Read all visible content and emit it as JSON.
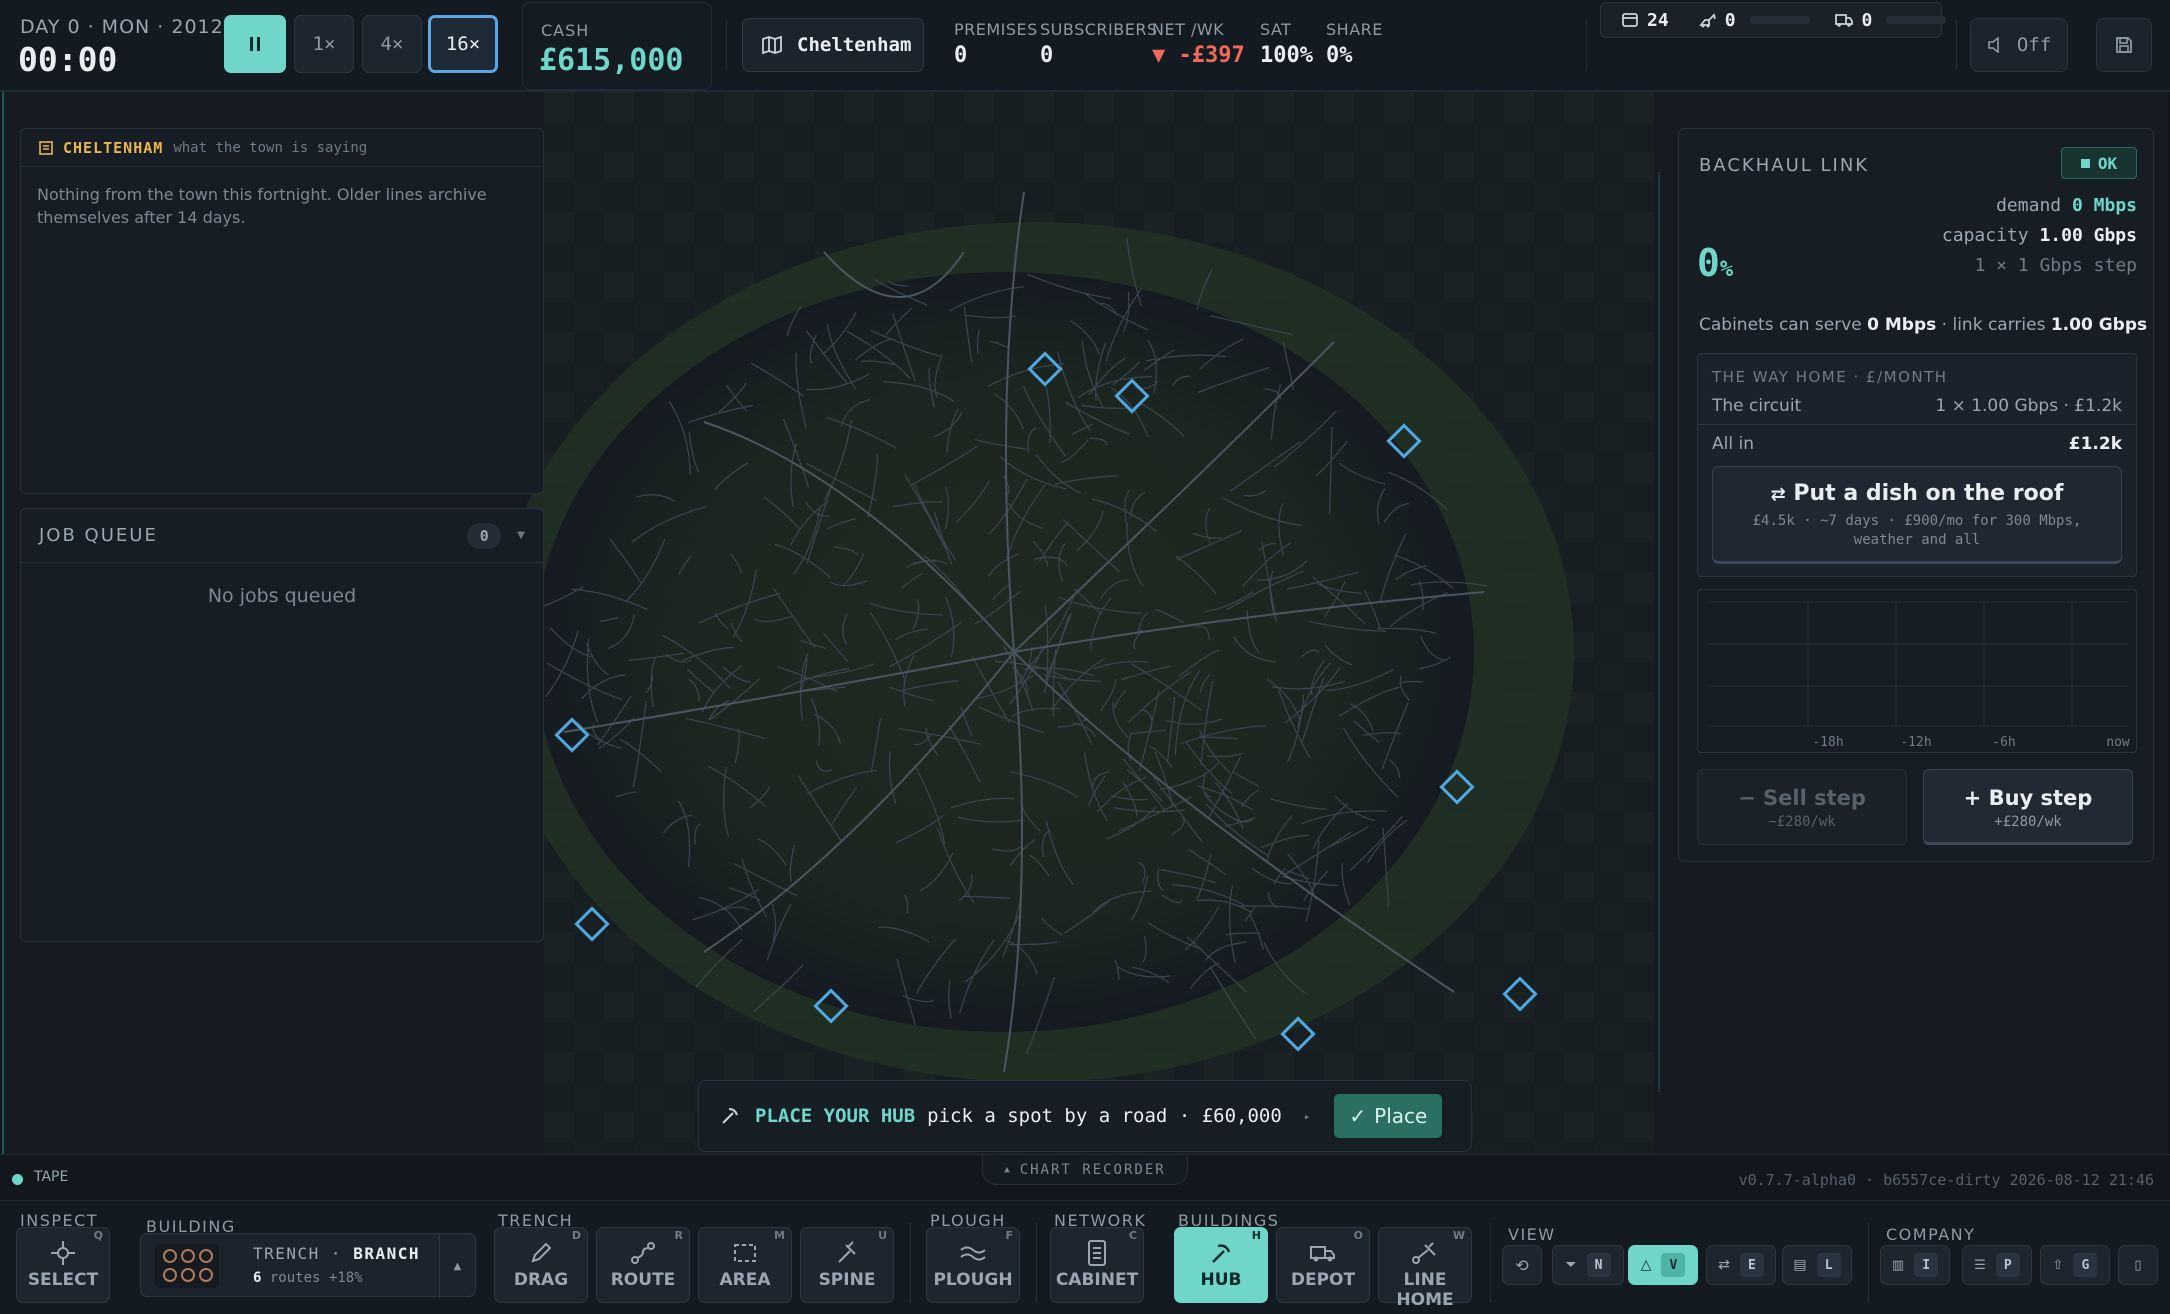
{
  "topbar": {
    "date": "DAY 0 · MON · 2012",
    "clock": "00:00",
    "speeds": [
      "1×",
      "4×",
      "16×"
    ],
    "cash_label": "CASH",
    "cash_value": "£615,000",
    "town": "Cheltenham",
    "stats": [
      {
        "label": "PREMISES",
        "value": "0"
      },
      {
        "label": "SUBSCRIBERS",
        "value": "0"
      },
      {
        "label": "NET /WK",
        "value": "▼ -£397"
      },
      {
        "label": "SAT",
        "value": "100%"
      },
      {
        "label": "SHARE",
        "value": "0%"
      }
    ],
    "resources": {
      "crews": "24",
      "diggers": "0",
      "vans": "0"
    },
    "sound_label": "Off"
  },
  "news": {
    "title": "CHELTENHAM",
    "subtitle": "what the town is saying",
    "body": "Nothing from the town this fortnight. Older lines archive themselves after 14 days."
  },
  "jobs": {
    "title": "JOB QUEUE",
    "count": "0",
    "empty": "No jobs queued"
  },
  "backhaul": {
    "title": "BACKHAUL LINK",
    "status": "OK",
    "utilization": "0",
    "utilization_unit": "%",
    "demand_label": "demand",
    "demand": "0 Mbps",
    "capacity_label": "capacity",
    "capacity": "1.00 Gbps",
    "step_note": "1 × 1 Gbps step",
    "serve_pre": "Cabinets can serve",
    "serve_val": "0 Mbps",
    "serve_mid": "· link carries",
    "carry_val": "1.00 Gbps",
    "way_title": "THE WAY HOME · £/MONTH",
    "circuit_label": "The circuit",
    "circuit_value": "1 × 1.00 Gbps · £1.2k",
    "allin_label": "All in",
    "allin_value": "£1.2k",
    "dish_title": "Put a dish on the roof",
    "dish_sub": "£4.5k · ~7 days · £900/mo for 300 Mbps, weather and all",
    "chart_ticks": [
      "-18h",
      "-12h",
      "-6h",
      "now"
    ],
    "sell_title": "− Sell step",
    "sell_sub": "−£280/wk",
    "buy_title": "+ Buy step",
    "buy_sub": "+£280/wk"
  },
  "hub_prompt": {
    "title": "PLACE YOUR HUB",
    "text": "pick a spot by a road · £60,000",
    "button": "Place"
  },
  "strip": {
    "tape": "TAPE",
    "chart_recorder": "CHART RECORDER",
    "version": "v0.7.7-alpha0 · b6557ce-dirty 2026-08-12 21:46"
  },
  "toolbar": {
    "groups": {
      "inspect": "INSPECT",
      "building": "BUILDING",
      "trench": "TRENCH",
      "plough": "PLOUGH",
      "network": "NETWORK",
      "buildings": "BUILDINGS",
      "view": "VIEW",
      "company": "COMPANY"
    },
    "building_mode": "TRENCH",
    "building_sub": "BRANCH",
    "building_routes": "6",
    "building_routes_label": "routes",
    "building_bonus": "+18%",
    "tools": [
      {
        "label": "SELECT",
        "key": "Q"
      },
      {
        "label": "DRAG",
        "key": "D"
      },
      {
        "label": "ROUTE",
        "key": "R"
      },
      {
        "label": "AREA",
        "key": "M"
      },
      {
        "label": "SPINE",
        "key": "U"
      },
      {
        "label": "PLOUGH",
        "key": "F"
      },
      {
        "label": "CABINET",
        "key": "C"
      },
      {
        "label": "HUB",
        "key": "H"
      },
      {
        "label": "DEPOT",
        "key": "O"
      },
      {
        "label": "LINE HOME",
        "key": "W"
      }
    ],
    "view_keys": [
      "N",
      "V",
      "E",
      "L"
    ],
    "company_keys": [
      "I",
      "P",
      "G"
    ]
  },
  "colors": {
    "accent": "#6fd6c9",
    "warning": "#e8b64c",
    "negative": "#ef6a5a",
    "marker": "#4fa8e0"
  }
}
